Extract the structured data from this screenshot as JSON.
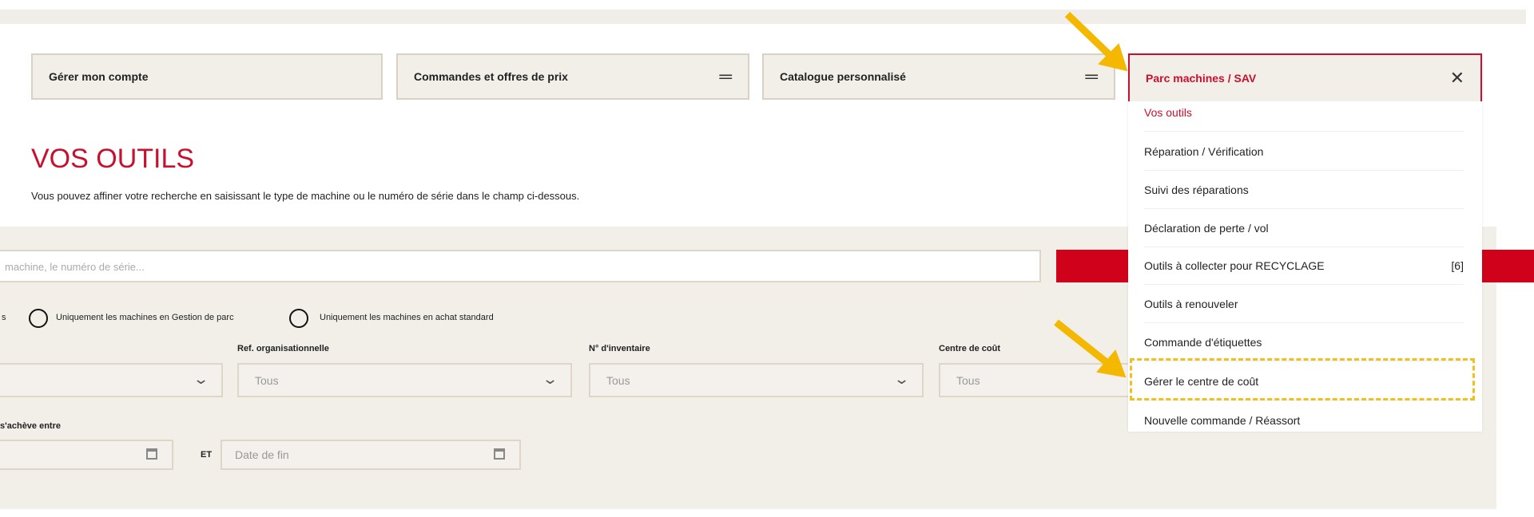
{
  "nav_tabs": [
    {
      "label": "Gérer mon compte",
      "icon": ""
    },
    {
      "label": "Commandes et offres de prix",
      "icon": "menu-equals-icon"
    },
    {
      "label": "Catalogue personnalisé",
      "icon": "menu-equals-icon"
    }
  ],
  "menu": {
    "title": "Parc machines / SAV",
    "close_icon": "close-icon",
    "items": [
      {
        "label": "Vos outils",
        "badge": ""
      },
      {
        "label": "Réparation / Vérification",
        "badge": ""
      },
      {
        "label": "Suivi des réparations",
        "badge": ""
      },
      {
        "label": "Déclaration de perte / vol",
        "badge": ""
      },
      {
        "label": "Outils à collecter pour RECYCLAGE",
        "badge": "[6]"
      },
      {
        "label": "Outils à renouveler",
        "badge": ""
      },
      {
        "label": "Commande d'étiquettes",
        "badge": ""
      },
      {
        "label": "Gérer le centre de coût",
        "badge": ""
      },
      {
        "label": "Nouvelle commande / Réassort",
        "badge": ""
      }
    ]
  },
  "page": {
    "title": "VOS OUTILS",
    "subtitle": "Vous pouvez affiner votre recherche en saisissant le type de machine ou le numéro de série dans le champ ci-dessous."
  },
  "search": {
    "placeholder": "machine, le numéro de série..."
  },
  "radios": {
    "partial": "s",
    "opt1": "Uniquement les machines en Gestion de parc",
    "opt2": "Uniquement les machines en achat standard"
  },
  "filters": {
    "ref_label": "Ref. organisationnelle",
    "ref_value": "Tous",
    "inv_label": "N° d'inventaire",
    "inv_value": "Tous",
    "cc_label": "Centre de coût",
    "cc_value": "Tous"
  },
  "dates": {
    "label": "s'achève entre",
    "and": "ET",
    "end_placeholder": "Date de fin"
  },
  "colors": {
    "accent": "#c8102e",
    "highlight": "#f0c020",
    "panel": "#f2efe9"
  }
}
